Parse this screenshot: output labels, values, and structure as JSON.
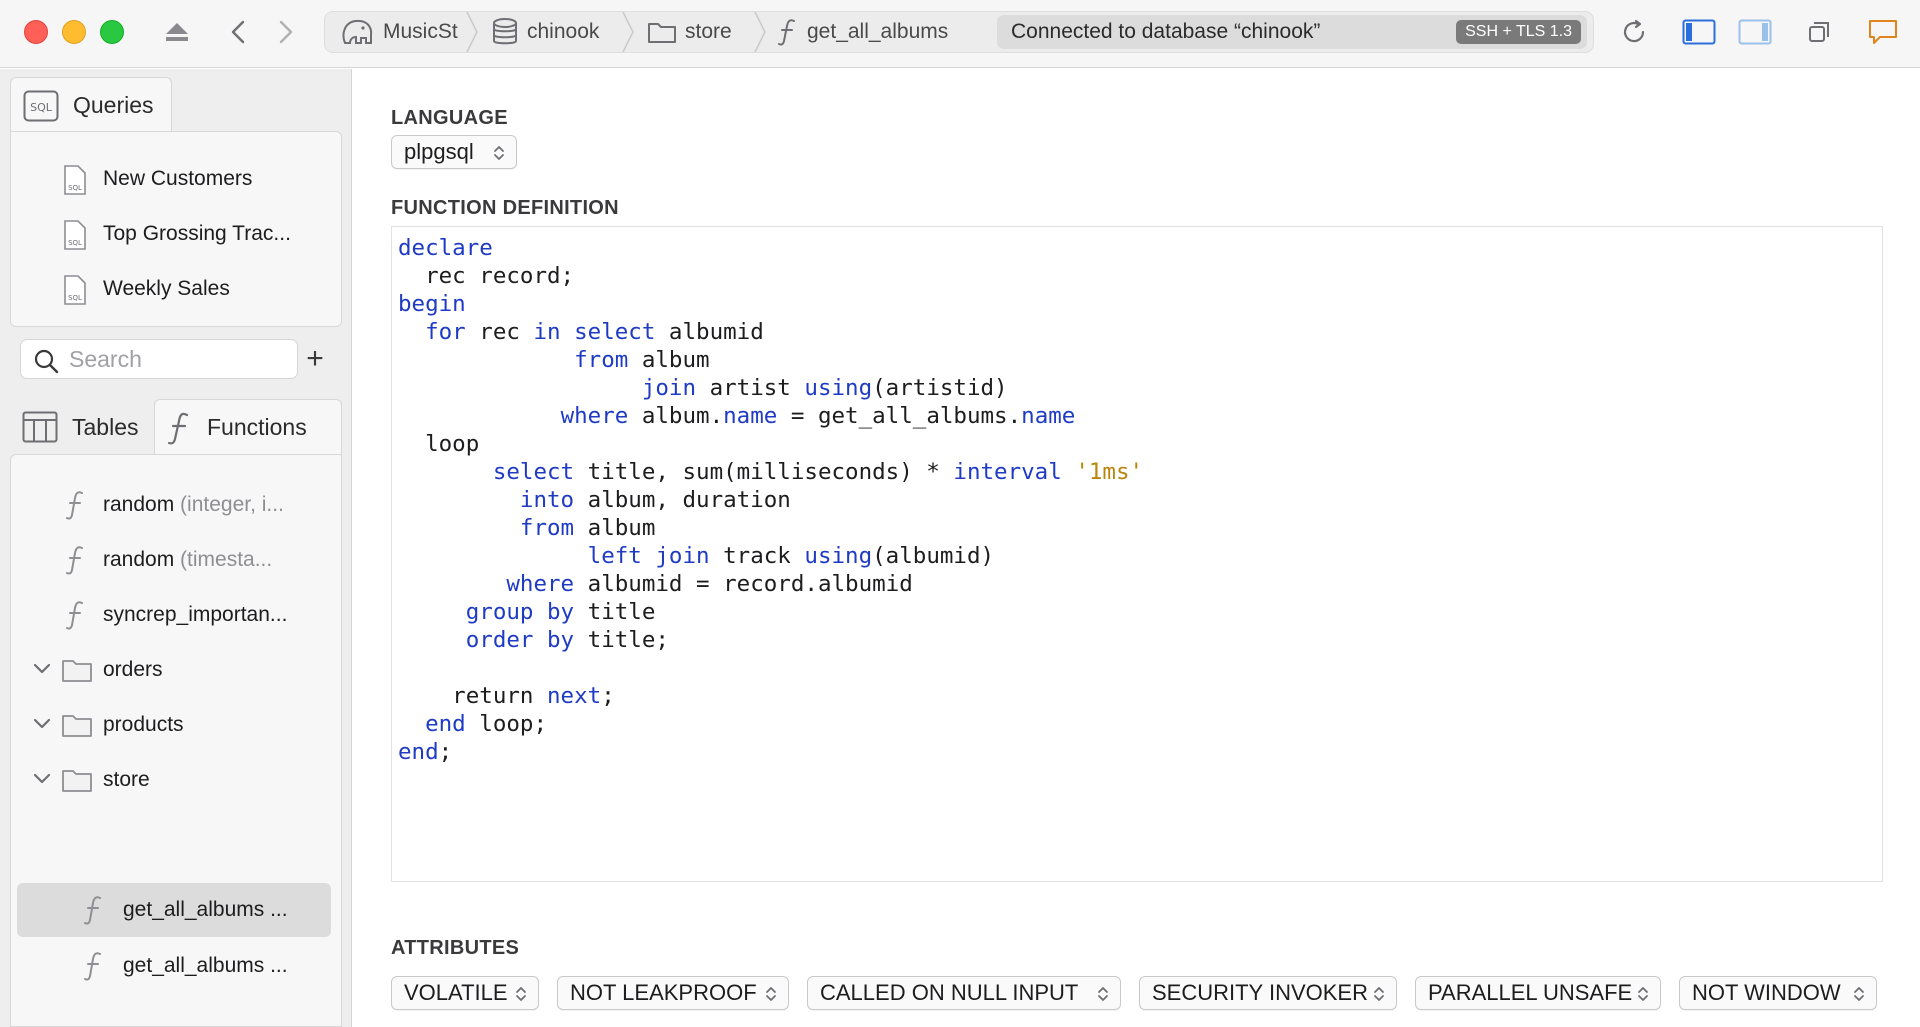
{
  "toolbar": {
    "breadcrumb": [
      {
        "label": "MusicSt",
        "icon": "elephant-icon"
      },
      {
        "label": "chinook",
        "icon": "database-icon"
      },
      {
        "label": "store",
        "icon": "folder-icon"
      },
      {
        "label": "get_all_albums",
        "icon": "function-icon"
      }
    ],
    "connection_status": "Connected to database “chinook”",
    "security_badge": "SSH + TLS 1.3"
  },
  "sidebar": {
    "queries_tab": "Queries",
    "queries": [
      "New Customers",
      "Top Grossing Trac...",
      "Weekly Sales"
    ],
    "search_placeholder": "Search",
    "add_label": "+",
    "tables_tab": "Tables",
    "functions_tab": "Functions",
    "functions": [
      {
        "name": "random",
        "args": "(integer, i..."
      },
      {
        "name": "random",
        "args": "(timesta..."
      },
      {
        "name": "syncrep_importan...",
        "args": ""
      }
    ],
    "folders": [
      "orders",
      "products",
      "store"
    ],
    "store_functions": [
      "get_all_albums ...",
      "get_all_albums ..."
    ]
  },
  "main": {
    "language_label": "LANGUAGE",
    "language_value": "plpgsql",
    "definition_label": "FUNCTION DEFINITION",
    "code_lines": [
      [
        [
          "k",
          "declare"
        ]
      ],
      [
        [
          "t",
          "  rec record;"
        ]
      ],
      [
        [
          "k",
          "begin"
        ]
      ],
      [
        [
          "t",
          "  "
        ],
        [
          "k",
          "for"
        ],
        [
          "t",
          " rec "
        ],
        [
          "k",
          "in"
        ],
        [
          "t",
          " "
        ],
        [
          "k",
          "select"
        ],
        [
          "t",
          " albumid"
        ]
      ],
      [
        [
          "t",
          "             "
        ],
        [
          "k",
          "from"
        ],
        [
          "t",
          " album"
        ]
      ],
      [
        [
          "t",
          "                  "
        ],
        [
          "k",
          "join"
        ],
        [
          "t",
          " artist "
        ],
        [
          "k",
          "using"
        ],
        [
          "t",
          "(artistid)"
        ]
      ],
      [
        [
          "t",
          "            "
        ],
        [
          "k",
          "where"
        ],
        [
          "t",
          " album."
        ],
        [
          "k",
          "name"
        ],
        [
          "t",
          " = get_all_albums."
        ],
        [
          "k",
          "name"
        ]
      ],
      [
        [
          "t",
          "  loop"
        ]
      ],
      [
        [
          "t",
          "       "
        ],
        [
          "k",
          "select"
        ],
        [
          "t",
          " title, sum(milliseconds) * "
        ],
        [
          "k",
          "interval"
        ],
        [
          "t",
          " "
        ],
        [
          "s",
          "'1ms'"
        ]
      ],
      [
        [
          "t",
          "         "
        ],
        [
          "k",
          "into"
        ],
        [
          "t",
          " album, duration"
        ]
      ],
      [
        [
          "t",
          "         "
        ],
        [
          "k",
          "from"
        ],
        [
          "t",
          " album"
        ]
      ],
      [
        [
          "t",
          "              "
        ],
        [
          "k",
          "left"
        ],
        [
          "t",
          " "
        ],
        [
          "k",
          "join"
        ],
        [
          "t",
          " track "
        ],
        [
          "k",
          "using"
        ],
        [
          "t",
          "(albumid)"
        ]
      ],
      [
        [
          "t",
          "        "
        ],
        [
          "k",
          "where"
        ],
        [
          "t",
          " albumid = record.albumid"
        ]
      ],
      [
        [
          "t",
          "     "
        ],
        [
          "k",
          "group"
        ],
        [
          "t",
          " "
        ],
        [
          "k",
          "by"
        ],
        [
          "t",
          " title"
        ]
      ],
      [
        [
          "t",
          "     "
        ],
        [
          "k",
          "order"
        ],
        [
          "t",
          " "
        ],
        [
          "k",
          "by"
        ],
        [
          "t",
          " title;"
        ]
      ],
      [
        [
          "t",
          ""
        ]
      ],
      [
        [
          "t",
          "    return "
        ],
        [
          "k",
          "next"
        ],
        [
          "t",
          ";"
        ]
      ],
      [
        [
          "t",
          "  "
        ],
        [
          "k",
          "end"
        ],
        [
          "t",
          " loop;"
        ]
      ],
      [
        [
          "k",
          "end"
        ],
        [
          "t",
          ";"
        ]
      ]
    ],
    "attributes_label": "ATTRIBUTES",
    "attributes": [
      "VOLATILE",
      "NOT LEAKPROOF",
      "CALLED ON NULL INPUT",
      "SECURITY INVOKER",
      "PARALLEL UNSAFE",
      "NOT WINDOW"
    ]
  },
  "colors": {
    "keyword": "#1f3bc4",
    "string": "#b9860b",
    "close": "#fe5f57",
    "minimize": "#febc2e",
    "zoom": "#28c840"
  }
}
